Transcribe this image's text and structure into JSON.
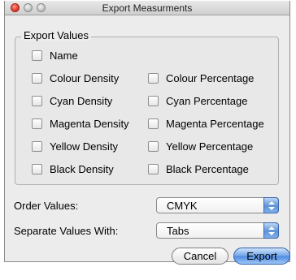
{
  "window": {
    "title": "Export Measurments"
  },
  "export_values": {
    "group_label": "Export Values",
    "name_label": "Name",
    "left_column": [
      "Colour Density",
      "Cyan Density",
      "Magenta Density",
      "Yellow Density",
      "Black Density"
    ],
    "right_column": [
      "Colour Percentage",
      "Cyan Percentage",
      "Magenta Percentage",
      "Yellow Percentage",
      "Black Percentage"
    ]
  },
  "order_values": {
    "label": "Order Values:",
    "selected": "CMYK"
  },
  "separate_values": {
    "label": "Separate Values With:",
    "selected": "Tabs"
  },
  "buttons": {
    "cancel": "Cancel",
    "export": "Export"
  }
}
